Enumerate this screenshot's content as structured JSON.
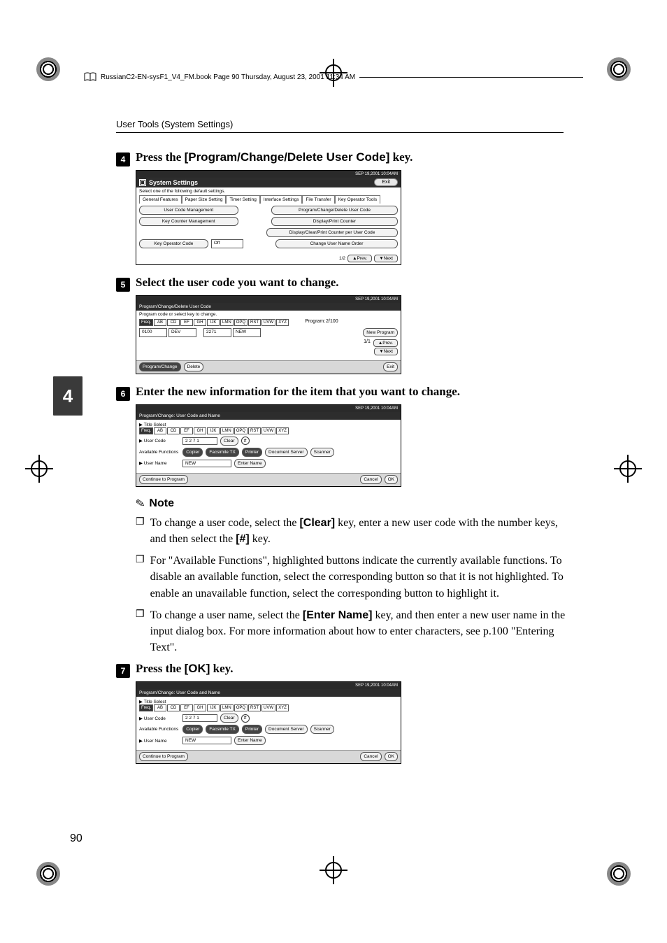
{
  "book_header": "RussianC2-EN-sysF1_V4_FM.book  Page 90  Thursday, August 23, 2001  11:34 AM",
  "section_title": "User Tools (System Settings)",
  "chapter_tab": "4",
  "page_number": "90",
  "steps": {
    "s4": {
      "num": "4",
      "prefix": "Press the ",
      "key": "[Program/Change/Delete User Code]",
      "suffix": " key."
    },
    "s5": {
      "num": "5",
      "text": "Select the user code you want to change."
    },
    "s6": {
      "num": "6",
      "text": "Enter the new information for the item that you want to change."
    },
    "s7": {
      "num": "7",
      "prefix": "Press the ",
      "key": "[OK]",
      "suffix": " key."
    }
  },
  "note": {
    "label": "Note",
    "items": [
      {
        "pre": "To change a user code, select the ",
        "k1": "[Clear]",
        "mid": " key, enter a new user code with the number keys, and then select the ",
        "k2": "[#]",
        "post": " key."
      },
      {
        "text": "For \"Available Functions\", highlighted buttons indicate the currently available functions.  To disable an available function, select the corresponding button so that it is not highlighted.  To enable an unavailable function, select the corresponding button to highlight it."
      },
      {
        "pre": "To change a user name, select the ",
        "k1": "[Enter Name]",
        "mid": " key, and then enter a new user name in the input dialog box.  For more information about how to enter characters, see p.100 \"Entering Text\"."
      }
    ]
  },
  "screenshots": {
    "sys_settings": {
      "title": "System Settings",
      "exit": "Exit",
      "subline": "Select one of the following default settings.",
      "tabs": [
        "General Features",
        "Paper Size Setting",
        "Timer Setting",
        "Interface Settings",
        "File Transfer",
        "Key Operator Tools"
      ],
      "left_buttons": [
        "User Code Management",
        "Key Counter Management",
        "",
        "Key Operator Code"
      ],
      "key_op_val": "Off",
      "right_buttons": [
        "Program/Change/Delete User Code",
        "Display/Print Counter",
        "Display/Clear/Print Counter per User Code",
        "Change User Name Order"
      ],
      "pager": {
        "page": "1/2",
        "prev": "▲Prev.",
        "next": "▼Next"
      }
    },
    "select_code": {
      "title": "Program/Change/Delete User Code",
      "subline": "Program code or select key to change.",
      "letters": [
        "Freq.",
        "AB",
        "CD",
        "EF",
        "GH",
        "IJK",
        "LMN",
        "OPQ",
        "RST",
        "UVW",
        "XYZ"
      ],
      "program_label": "Program:",
      "program_count": "2/100",
      "codes": [
        {
          "id": "0100",
          "name": "DEV"
        },
        {
          "id": "2271",
          "name": "NEW"
        }
      ],
      "new_program": "New Program",
      "pager": {
        "page": "1/1",
        "prev": "▲Prev.",
        "next": "▼Next"
      },
      "confirm": "Program/Change",
      "delete": "Delete",
      "exit": "Exit"
    },
    "change_code": {
      "title": "Program/Change: User Code and Name",
      "title_select": "▶ Title Select",
      "letters": [
        "Freq.",
        "AB",
        "CD",
        "EF",
        "GH",
        "IJK",
        "LMN",
        "OPQ",
        "RST",
        "UVW",
        "XYZ"
      ],
      "user_code_lbl": "▶ User Code",
      "user_code_val": "2 2 7 1",
      "clear": "Clear",
      "hash": "#",
      "avail_lbl": "Available Functions",
      "functions": [
        "Copier",
        "Facsimile TX",
        "Printer",
        "Document Server",
        "Scanner"
      ],
      "user_name_lbl": "▶ User Name",
      "user_name_val": "NEW",
      "enter_name": "Enter Name",
      "continue": "Continue to Program",
      "cancel": "Cancel",
      "ok": "OK"
    }
  }
}
